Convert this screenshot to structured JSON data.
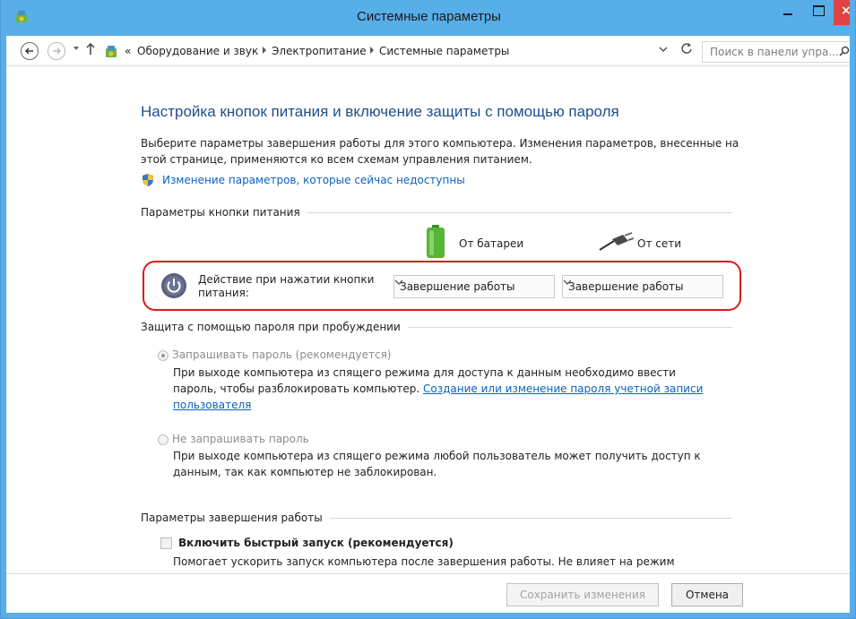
{
  "window": {
    "title": "Системные параметры",
    "close_glyph": "×"
  },
  "address_bar": {
    "prefix": "«",
    "crumbs": [
      "Оборудование и звук",
      "Электропитание",
      "Системные параметры"
    ],
    "search_placeholder": "Поиск в панели упра..."
  },
  "main": {
    "title": "Настройка кнопок питания и включение защиты с помощью пароля",
    "description": "Выберите параметры завершения работы для этого компьютера. Изменения параметров, внесенные на этой странице, применяются ко всем схемам управления питанием.",
    "change_link": "Изменение параметров, которые сейчас недоступны"
  },
  "power_buttons": {
    "group_title": "Параметры кнопки питания",
    "battery_label": "От батареи",
    "ac_label": "От сети",
    "action_label": "Действие при нажатии кнопки питания:",
    "battery_value": "Завершение работы",
    "ac_value": "Завершение работы"
  },
  "password": {
    "group_title": "Защита с помощью пароля при пробуждении",
    "require_label": "Запрашивать пароль (рекомендуется)",
    "require_desc": "При выходе компьютера из спящего режима для доступа к данным необходимо ввести пароль, чтобы разблокировать компьютер. ",
    "require_link": "Создание или изменение пароля учетной записи пользователя",
    "norequire_label": "Не запрашивать пароль",
    "norequire_desc": "При выходе компьютера из спящего режима любой пользователь может получить доступ к данным, так как компьютер не заблокирован."
  },
  "shutdown": {
    "group_title": "Параметры завершения работы",
    "fast_startup_label": "Включить быстрый запуск (рекомендуется)",
    "fast_startup_desc": "Помогает ускорить запуск компьютера после завершения работы. Не влияет на режим"
  },
  "footer": {
    "save_label": "Сохранить изменения",
    "cancel_label": "Отмена"
  },
  "colors": {
    "title_bar": "#58aee8",
    "link": "#0b62c0",
    "page_title": "#1e4e8c",
    "highlight": "#d91c1c",
    "close_button": "#e04343"
  }
}
